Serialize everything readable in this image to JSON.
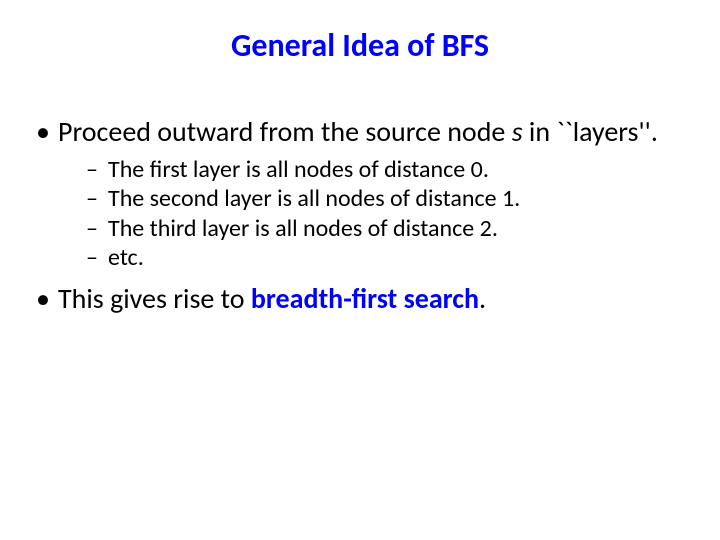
{
  "title": "General Idea of BFS",
  "bullets": {
    "b1": {
      "pre": "Proceed outward from the source node ",
      "var": "s",
      "post": " in ``layers''."
    },
    "sub": [
      "The first layer is all nodes of distance 0.",
      "The second layer is all nodes of distance 1.",
      "The third layer is all nodes of distance 2.",
      "etc."
    ],
    "b2": {
      "pre": " This gives rise to ",
      "strong": "breadth-first search",
      "post": "."
    }
  }
}
